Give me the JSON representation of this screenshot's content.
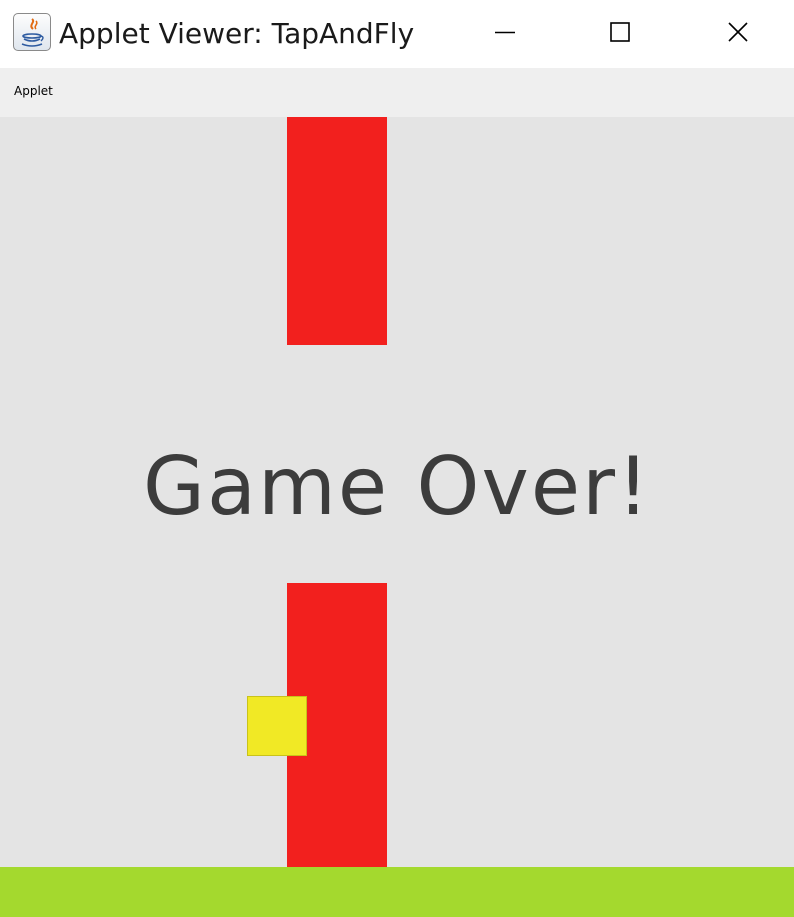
{
  "window": {
    "title": "Applet Viewer: TapAndFly",
    "app_icon": "java-coffee-cup-icon",
    "controls": [
      "minimize-icon",
      "maximize-icon",
      "close-icon"
    ]
  },
  "menubar": {
    "items": [
      {
        "label": "Applet"
      }
    ]
  },
  "game": {
    "status_text": "Game Over!",
    "colors": {
      "background": "#e4e4e4",
      "pipe": "#f2201e",
      "bird": "#f1e925",
      "ground": "#a4d92e",
      "text": "#3c3c3c"
    }
  }
}
